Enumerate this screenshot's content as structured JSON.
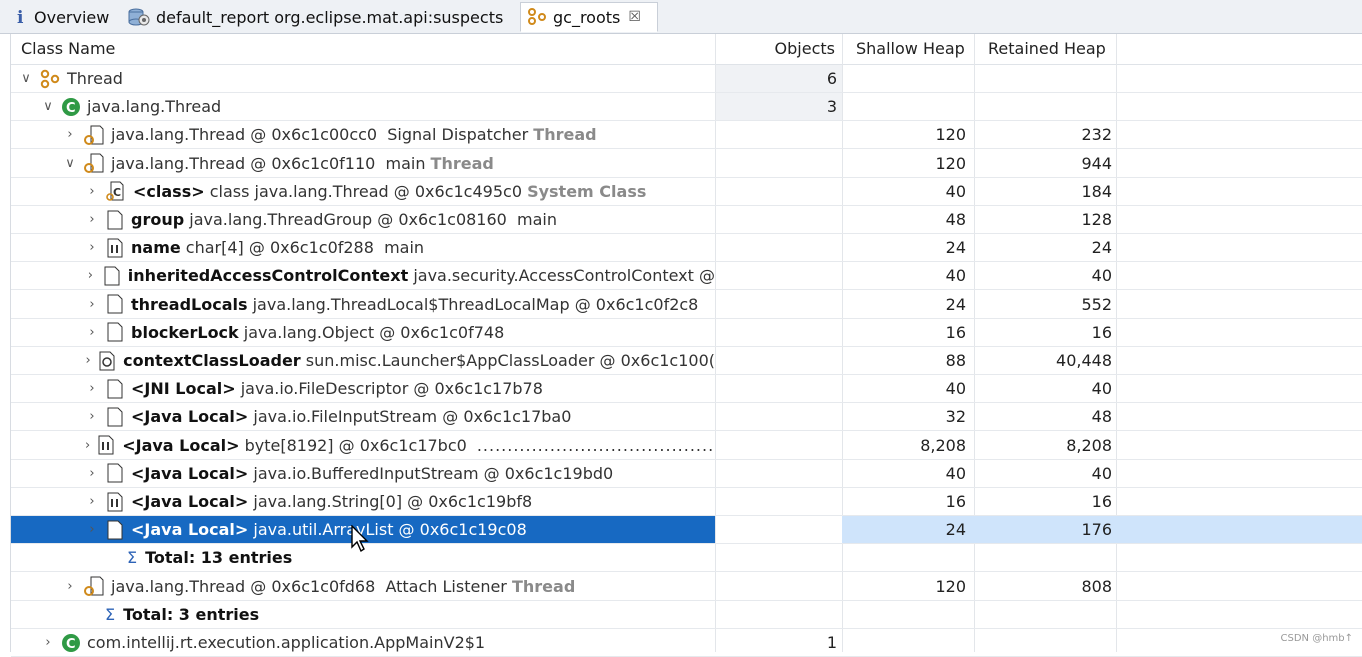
{
  "tabs": [
    {
      "label": "Overview",
      "icon": "info-icon",
      "active": false
    },
    {
      "label": "default_report  org.eclipse.mat.api:suspects",
      "icon": "report-icon",
      "active": false
    },
    {
      "label": "gc_roots",
      "icon": "gc-roots-icon",
      "active": true,
      "close": "☒"
    }
  ],
  "columns": {
    "class_name": "Class Name",
    "objects": "Objects",
    "shallow": "Shallow Heap",
    "retained": "Retained Heap"
  },
  "rows": [
    {
      "twisty": "∨",
      "icon": "gc-roots-icon",
      "bold": "",
      "rest": "Thread",
      "suffix": "",
      "objects": "6",
      "shallow": "",
      "retained": ""
    },
    {
      "twisty": "∨",
      "icon": "class-c-icon",
      "bold": "",
      "rest": "java.lang.Thread",
      "suffix": "",
      "objects": "3",
      "shallow": "",
      "retained": ""
    },
    {
      "twisty": "›",
      "icon": "thread-object-icon",
      "bold": "",
      "rest": "java.lang.Thread @ 0x6c1c00cc0  Signal Dispatcher ",
      "suffix": "Thread",
      "objects": "",
      "shallow": "120",
      "retained": "232"
    },
    {
      "twisty": "∨",
      "icon": "thread-object-icon",
      "bold": "",
      "rest": "java.lang.Thread @ 0x6c1c0f110  main ",
      "suffix": "Thread",
      "objects": "",
      "shallow": "120",
      "retained": "944"
    },
    {
      "twisty": "›",
      "icon": "class-object-icon",
      "bold": "<class>",
      "rest": " class java.lang.Thread @ 0x6c1c495c0 ",
      "suffix": "System Class",
      "objects": "",
      "shallow": "40",
      "retained": "184"
    },
    {
      "twisty": "›",
      "icon": "object-icon",
      "bold": "group",
      "rest": " java.lang.ThreadGroup @ 0x6c1c08160  main",
      "suffix": "",
      "objects": "",
      "shallow": "48",
      "retained": "128"
    },
    {
      "twisty": "›",
      "icon": "array-icon",
      "bold": "name",
      "rest": " char[4] @ 0x6c1c0f288  main",
      "suffix": "",
      "objects": "",
      "shallow": "24",
      "retained": "24"
    },
    {
      "twisty": "›",
      "icon": "object-icon",
      "bold": "inheritedAccessControlContext",
      "rest": " java.security.AccessControlContext @",
      "suffix": "",
      "objects": "",
      "shallow": "40",
      "retained": "40"
    },
    {
      "twisty": "›",
      "icon": "object-icon",
      "bold": "threadLocals",
      "rest": " java.lang.ThreadLocal$ThreadLocalMap @ 0x6c1c0f2c8",
      "suffix": "",
      "objects": "",
      "shallow": "24",
      "retained": "552"
    },
    {
      "twisty": "›",
      "icon": "object-icon",
      "bold": "blockerLock",
      "rest": " java.lang.Object @ 0x6c1c0f748",
      "suffix": "",
      "objects": "",
      "shallow": "16",
      "retained": "16"
    },
    {
      "twisty": "›",
      "icon": "classloader-icon",
      "bold": "contextClassLoader",
      "rest": " sun.misc.Launcher$AppClassLoader @ 0x6c1c100(",
      "suffix": "",
      "objects": "",
      "shallow": "88",
      "retained": "40,448"
    },
    {
      "twisty": "›",
      "icon": "object-icon",
      "bold": "<JNI Local>",
      "rest": " java.io.FileDescriptor @ 0x6c1c17b78",
      "suffix": "",
      "objects": "",
      "shallow": "40",
      "retained": "40"
    },
    {
      "twisty": "›",
      "icon": "object-icon",
      "bold": "<Java Local>",
      "rest": " java.io.FileInputStream @ 0x6c1c17ba0",
      "suffix": "",
      "objects": "",
      "shallow": "32",
      "retained": "48"
    },
    {
      "twisty": "›",
      "icon": "array-icon",
      "bold": "<Java Local>",
      "rest": " byte[8192] @ 0x6c1c17bc0",
      "suffix": "",
      "dots": "..........................................",
      "objects": "",
      "shallow": "8,208",
      "retained": "8,208"
    },
    {
      "twisty": "›",
      "icon": "object-icon",
      "bold": "<Java Local>",
      "rest": " java.io.BufferedInputStream @ 0x6c1c19bd0",
      "suffix": "",
      "objects": "",
      "shallow": "40",
      "retained": "40"
    },
    {
      "twisty": "›",
      "icon": "array-icon",
      "bold": "<Java Local>",
      "rest": " java.lang.String[0] @ 0x6c1c19bf8",
      "suffix": "",
      "objects": "",
      "shallow": "16",
      "retained": "16"
    },
    {
      "twisty": "›",
      "icon": "object-icon",
      "bold": "<Java Local>",
      "rest": " java.util.ArrayList @ 0x6c1c19c08",
      "suffix": "",
      "objects": "",
      "shallow": "24",
      "retained": "176",
      "selected": true
    },
    {
      "twisty": "",
      "icon": "sum-icon",
      "bold": "Total: 13 entries",
      "rest": "",
      "suffix": "",
      "objects": "",
      "shallow": "",
      "retained": ""
    },
    {
      "twisty": "›",
      "icon": "thread-object-icon",
      "bold": "",
      "rest": "java.lang.Thread @ 0x6c1c0fd68  Attach Listener ",
      "suffix": "Thread",
      "objects": "",
      "shallow": "120",
      "retained": "808"
    },
    {
      "twisty": "",
      "icon": "sum-icon",
      "bold": "Total: 3 entries",
      "rest": "",
      "suffix": "",
      "objects": "",
      "shallow": "",
      "retained": ""
    },
    {
      "twisty": "›",
      "icon": "class-c-icon",
      "bold": "",
      "rest": "com.intellij.rt.execution.application.AppMainV2$1",
      "suffix": "",
      "objects": "1",
      "shallow": "",
      "retained": ""
    }
  ],
  "sigma_glyph": "Σ",
  "watermark": "CSDN @hmb↑"
}
